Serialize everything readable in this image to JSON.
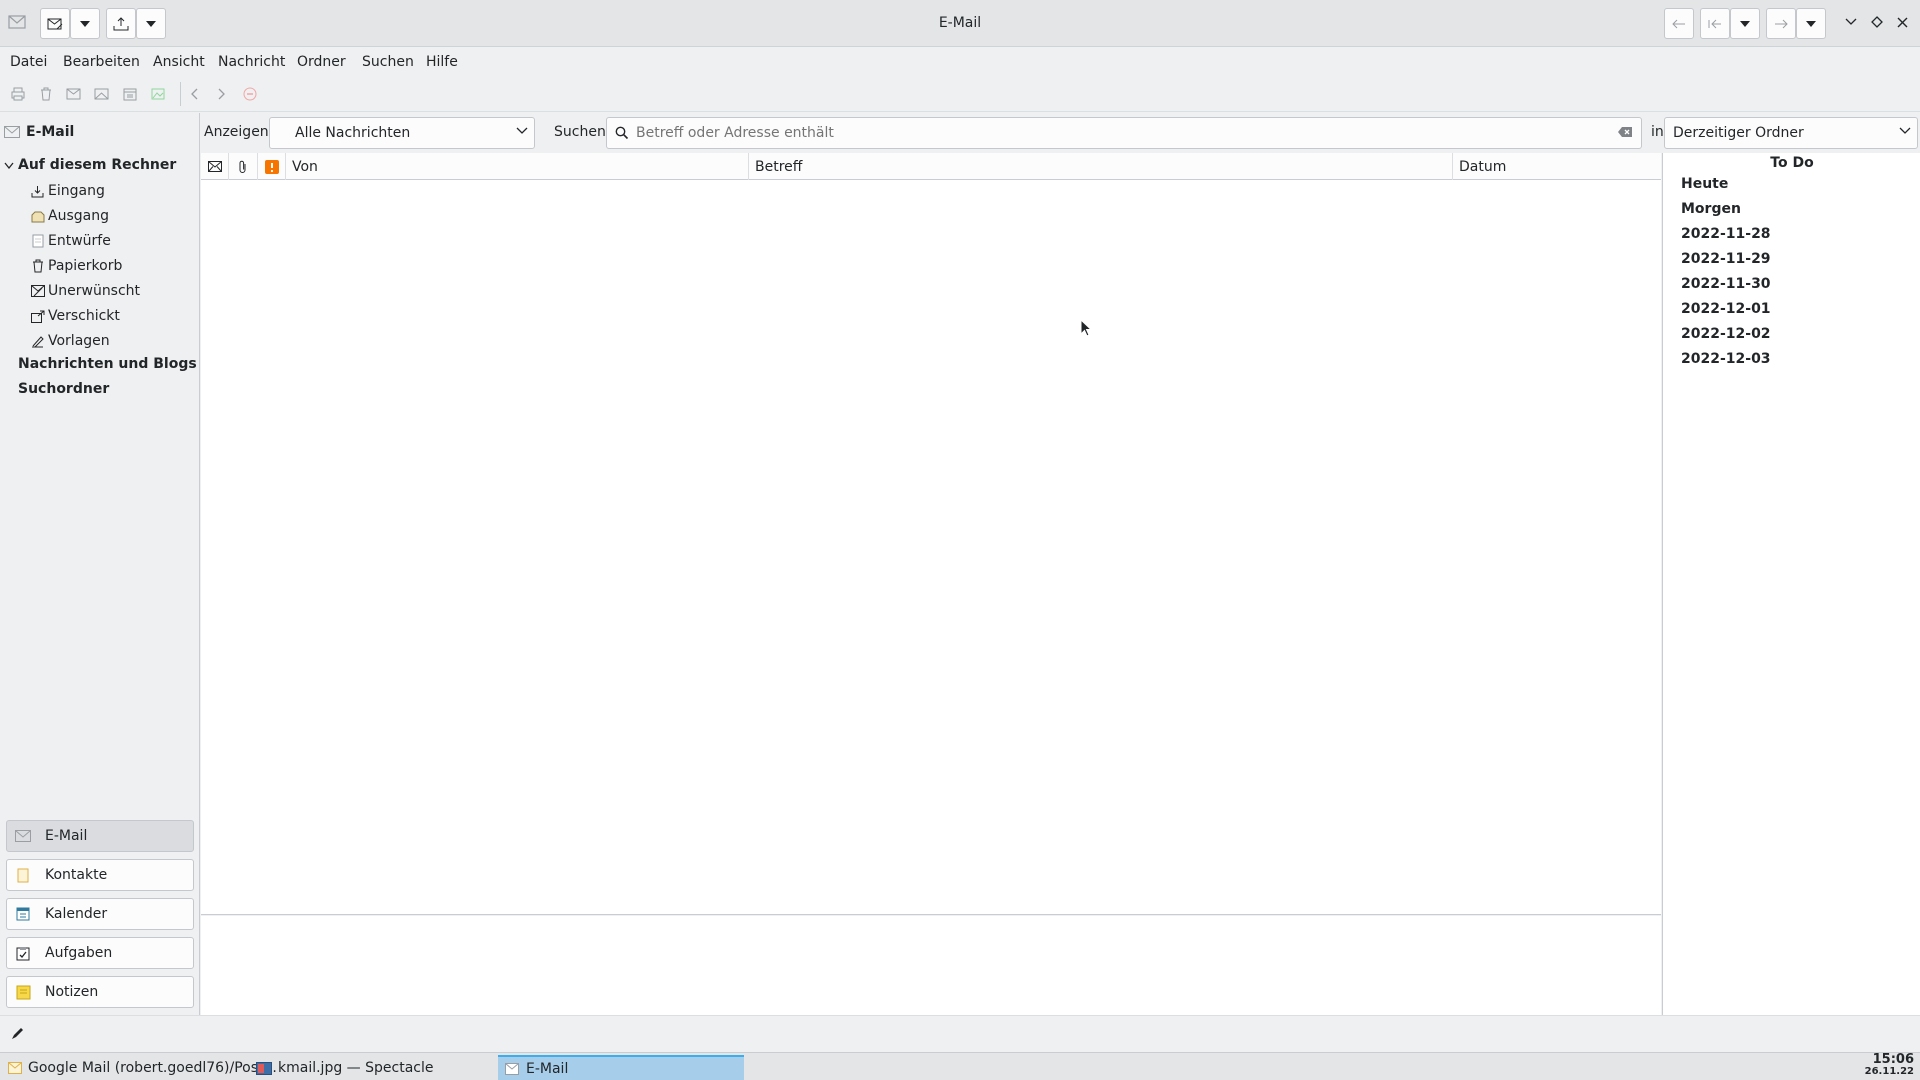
{
  "window": {
    "title": "E-Mail"
  },
  "menu": [
    "Datei",
    "Bearbeiten",
    "Ansicht",
    "Nachricht",
    "Ordner",
    "Suchen",
    "Hilfe"
  ],
  "sidebar": {
    "header": "E-Mail",
    "account": "Auf diesem Rechner",
    "folders": [
      {
        "label": "Eingang",
        "icon": "inbox-icon"
      },
      {
        "label": "Ausgang",
        "icon": "outbox-icon"
      },
      {
        "label": "Entwürfe",
        "icon": "drafts-icon"
      },
      {
        "label": "Papierkorb",
        "icon": "trash-icon"
      },
      {
        "label": "Unerwünscht",
        "icon": "junk-icon"
      },
      {
        "label": "Verschickt",
        "icon": "sent-icon"
      },
      {
        "label": "Vorlagen",
        "icon": "templates-icon"
      }
    ],
    "groups": [
      "Nachrichten und Blogs",
      "Suchordner"
    ],
    "switcher": [
      {
        "label": "E-Mail",
        "icon": "mail-icon",
        "active": true
      },
      {
        "label": "Kontakte",
        "icon": "contacts-icon",
        "active": false
      },
      {
        "label": "Kalender",
        "icon": "calendar-icon",
        "active": false
      },
      {
        "label": "Aufgaben",
        "icon": "tasks-icon",
        "active": false
      },
      {
        "label": "Notizen",
        "icon": "notes-icon",
        "active": false
      }
    ]
  },
  "filter": {
    "show_label": "Anzeigen:",
    "show_value": "Alle Nachrichten",
    "search_label": "Suchen:",
    "search_placeholder": "Betreff oder Adresse enthält",
    "search_value": "",
    "in_label": "in",
    "scope_value": "Derzeitiger Ordner"
  },
  "columns": [
    "Von",
    "Betreff",
    "Datum"
  ],
  "messages": [],
  "todo": {
    "title": "To Do",
    "items": [
      "Heute",
      "Morgen",
      "2022-11-28",
      "2022-11-29",
      "2022-11-30",
      "2022-12-01",
      "2022-12-02",
      "2022-12-03"
    ]
  },
  "taskbar": {
    "tasks": [
      {
        "label": "Google Mail (robert.goedl76)/Post...",
        "active": false
      },
      {
        "label": "kmail.jpg — Spectacle",
        "active": false
      },
      {
        "label": "E-Mail",
        "active": true
      }
    ],
    "clock_time": "15:06",
    "clock_date": "26.11.22"
  },
  "colors": {
    "accent": "#3daee9",
    "active_task": "#a6cde9",
    "priority": "#f67400"
  }
}
